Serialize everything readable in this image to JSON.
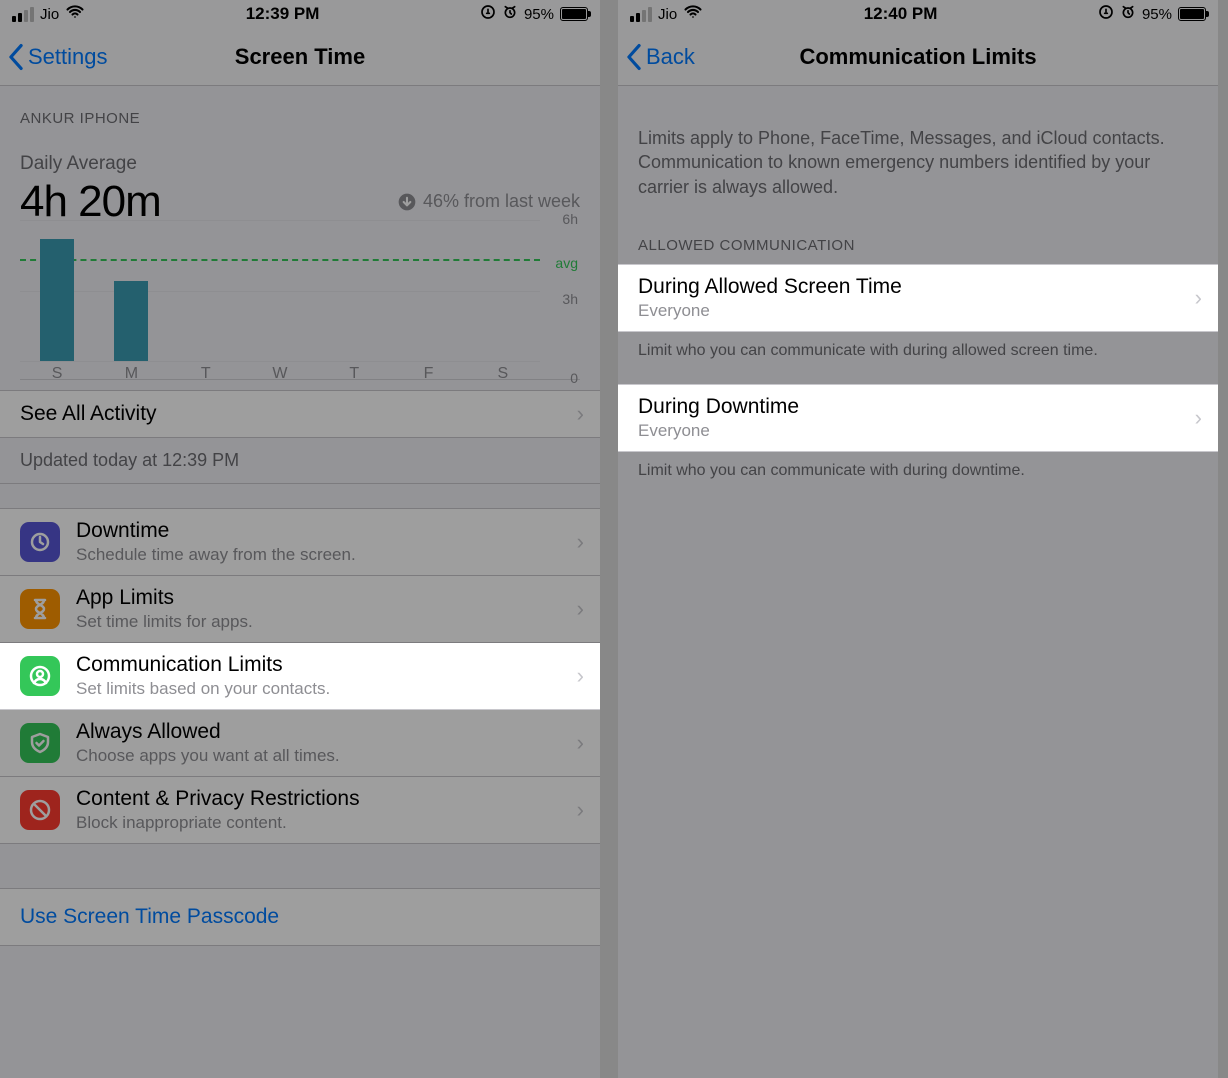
{
  "left": {
    "status": {
      "carrier": "Jio",
      "time": "12:39 PM",
      "battery": "95%"
    },
    "nav": {
      "back": "Settings",
      "title": "Screen Time"
    },
    "device_header": "ANKUR IPHONE",
    "daily_label": "Daily Average",
    "daily_value": "4h 20m",
    "trend": "46% from last week",
    "see_all": "See All Activity",
    "updated": "Updated today at 12:39 PM",
    "rows": {
      "downtime": {
        "title": "Downtime",
        "sub": "Schedule time away from the screen."
      },
      "app_limits": {
        "title": "App Limits",
        "sub": "Set time limits for apps."
      },
      "comm_limits": {
        "title": "Communication Limits",
        "sub": "Set limits based on your contacts."
      },
      "always": {
        "title": "Always Allowed",
        "sub": "Choose apps you want at all times."
      },
      "content": {
        "title": "Content & Privacy Restrictions",
        "sub": "Block inappropriate content."
      }
    },
    "passcode": "Use Screen Time Passcode"
  },
  "right": {
    "status": {
      "carrier": "Jio",
      "time": "12:40 PM",
      "battery": "95%"
    },
    "nav": {
      "back": "Back",
      "title": "Communication Limits"
    },
    "desc": "Limits apply to Phone, FaceTime, Messages, and iCloud contacts. Communication to known emergency numbers identified by your carrier is always allowed.",
    "section_header": "ALLOWED COMMUNICATION",
    "row1": {
      "title": "During Allowed Screen Time",
      "value": "Everyone"
    },
    "foot1": "Limit who you can communicate with during allowed screen time.",
    "row2": {
      "title": "During Downtime",
      "value": "Everyone"
    },
    "foot2": "Limit who you can communicate with during downtime."
  },
  "chart_data": {
    "type": "bar",
    "title": "Daily Average 4h 20m",
    "categories": [
      "S",
      "M",
      "T",
      "W",
      "T",
      "F",
      "S"
    ],
    "values": [
      5.2,
      3.4,
      0,
      0,
      0,
      0,
      0
    ],
    "avg": 4.33,
    "ylim": [
      0,
      6
    ],
    "ylabel": "hours",
    "y_ticks": [
      {
        "v": 6,
        "label": "6h"
      },
      {
        "v": 3,
        "label": "3h"
      },
      {
        "v": 0,
        "label": "0"
      }
    ],
    "avg_label": "avg"
  }
}
